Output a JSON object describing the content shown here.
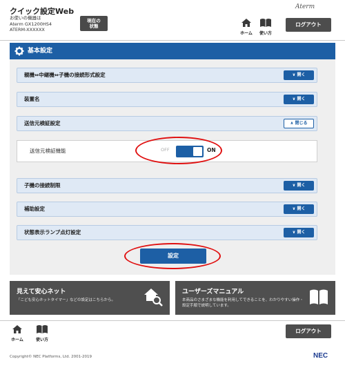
{
  "header": {
    "title": "クイック設定Web",
    "device_caption": "お使いの機器は",
    "device_model": "Aterm GX1200HS4",
    "device_id": "ATERM-XXXXXX",
    "status_button_line1": "現在の",
    "status_button_line2": "状態",
    "brand": "Aterm",
    "home_label": "ホーム",
    "help_label": "使い方",
    "logout_label": "ログアウト"
  },
  "panel": {
    "title": "基本設定",
    "sections": [
      {
        "label": "親機⇔中継機⇔子機の接続形式設定",
        "button": "開く"
      },
      {
        "label": "装置名",
        "button": "開く"
      },
      {
        "label": "送信元検証設定",
        "button": "閉じる"
      },
      {
        "label": "子機の接続制限",
        "button": "開く"
      },
      {
        "label": "補助設定",
        "button": "開く"
      },
      {
        "label": "状態表示ランプ点灯設定",
        "button": "開く"
      }
    ],
    "source_verification": {
      "label": "送信元検証機能",
      "off_label": "OFF",
      "on_label": "ON",
      "enabled": true
    },
    "submit_label": "設定"
  },
  "banners": [
    {
      "title": "見えて安心ネット",
      "desc": "「こども安心ネットタイマー」などの設定はこちらから。",
      "icon": "house-search-icon"
    },
    {
      "title": "ユーザーズマニュアル",
      "desc": "本商品のさまざまな機能を利用してできることを、わかりやすい操作・設定手順で説明しています。",
      "icon": "book-icon"
    }
  ],
  "footer": {
    "home_label": "ホーム",
    "help_label": "使い方",
    "logout_label": "ログアウト",
    "copyright": "Copyright© NEC Platforms, Ltd. 2001-2019",
    "logo": "NEC"
  },
  "colors": {
    "primary": "#1d5fa5",
    "section_bg": "#dfe9f5",
    "banner_bg": "#4f4f4f",
    "highlight": "#e01010"
  }
}
